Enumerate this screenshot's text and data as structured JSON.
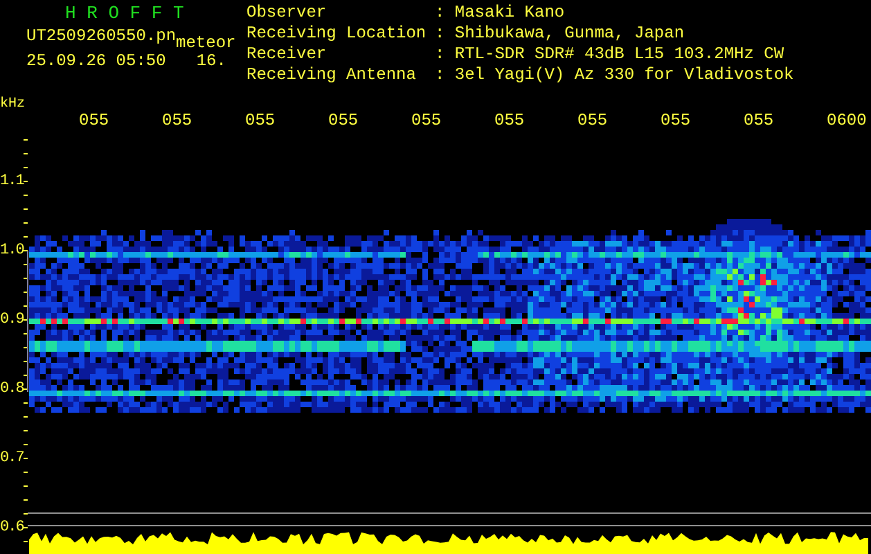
{
  "header": {
    "app_title": "H R O F F T",
    "file_name": "UT2509260550.pn",
    "file_type": "meteor",
    "date_time": "25.09.26 05:50",
    "count": "16."
  },
  "station_info": [
    {
      "label": "Observer",
      "value": ": Masaki Kano"
    },
    {
      "label": "Receiving Location",
      "value": ": Shibukawa, Gunma, Japan"
    },
    {
      "label": "Receiver",
      "value": ": RTL-SDR SDR# 43dB L15 103.2MHz CW"
    },
    {
      "label": "Receiving Antenna",
      "value": ": 3el Yagi(V) Az 330 for Vladivostok"
    }
  ],
  "time_axis": {
    "labels": [
      "055",
      "055",
      "055",
      "055",
      "055",
      "055",
      "055",
      "055",
      "055",
      "0600"
    ]
  },
  "frequency_axis": {
    "unit": "kHz",
    "ticks": [
      "1.1",
      "1.0",
      "0.9",
      "0.8",
      "0.7",
      "0.6"
    ]
  }
}
